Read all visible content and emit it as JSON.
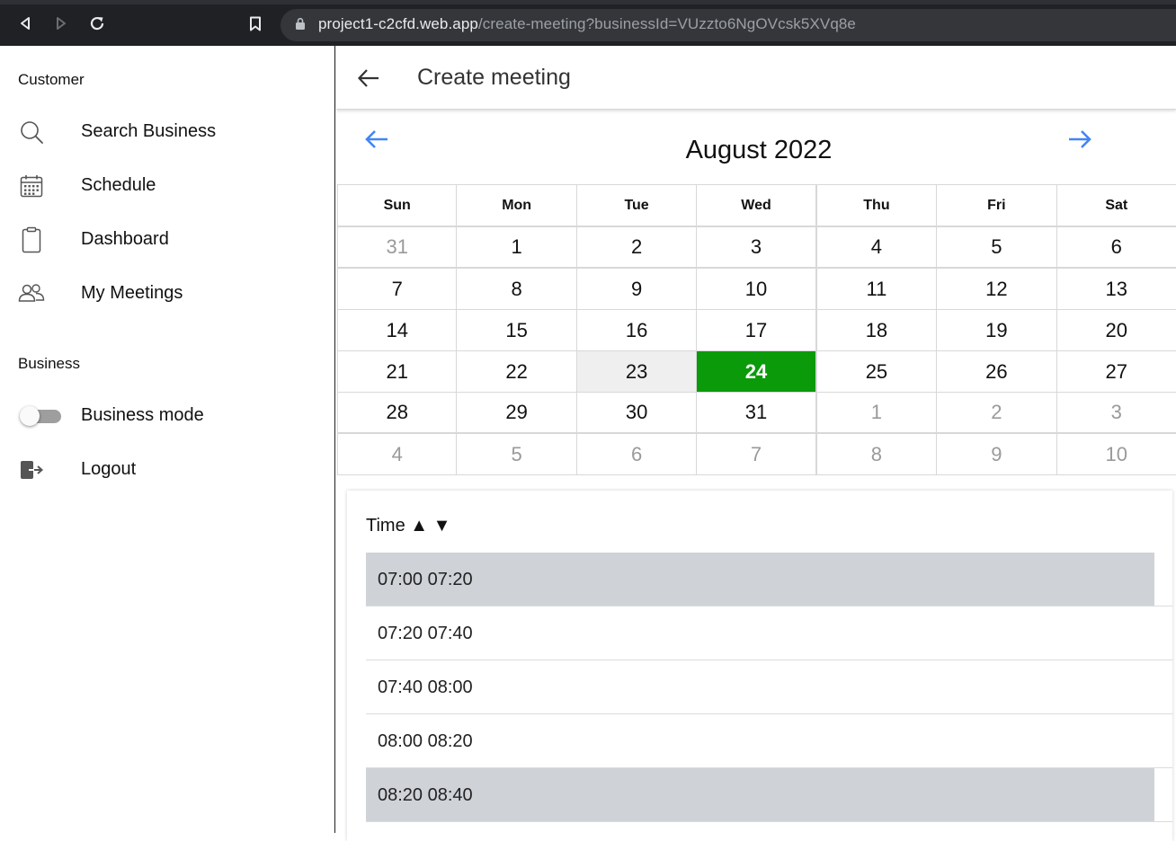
{
  "browser": {
    "url_host": "project1-c2cfd.web.app",
    "url_path": "/create-meeting?businessId=VUzzto6NgOVcsk5XVq8e"
  },
  "sidebar": {
    "customer_label": "Customer",
    "items": [
      {
        "label": "Search Business",
        "icon": "search-icon"
      },
      {
        "label": "Schedule",
        "icon": "calendar-icon"
      },
      {
        "label": "Dashboard",
        "icon": "clipboard-icon"
      },
      {
        "label": "My Meetings",
        "icon": "people-icon"
      }
    ],
    "business_label": "Business",
    "business_mode": {
      "label": "Business mode",
      "enabled": false
    },
    "logout": {
      "label": "Logout",
      "icon": "logout-icon"
    }
  },
  "header": {
    "title": "Create meeting"
  },
  "calendar": {
    "month_label": "August 2022",
    "weekdays": [
      "Sun",
      "Mon",
      "Tue",
      "Wed",
      "Thu",
      "Fri",
      "Sat"
    ],
    "weeks": [
      [
        "31",
        "1",
        "2",
        "3",
        "4",
        "5",
        "6"
      ],
      [
        "7",
        "8",
        "9",
        "10",
        "11",
        "12",
        "13"
      ],
      [
        "14",
        "15",
        "16",
        "17",
        "18",
        "19",
        "20"
      ],
      [
        "21",
        "22",
        "23",
        "24",
        "25",
        "26",
        "27"
      ],
      [
        "28",
        "29",
        "30",
        "31",
        "1",
        "2",
        "3"
      ],
      [
        "4",
        "5",
        "6",
        "7",
        "8",
        "9",
        "10"
      ]
    ],
    "selected_day": "24",
    "accent_color": "#0a9a0a",
    "nav_color": "#4285f4"
  },
  "time_slots": {
    "header": "Time ▲ ▼",
    "slots": [
      {
        "label": "07:00 07:20",
        "busy": true
      },
      {
        "label": "07:20 07:40",
        "busy": false
      },
      {
        "label": "07:40 08:00",
        "busy": false
      },
      {
        "label": "08:00 08:20",
        "busy": false
      },
      {
        "label": "08:20 08:40",
        "busy": true
      }
    ]
  }
}
